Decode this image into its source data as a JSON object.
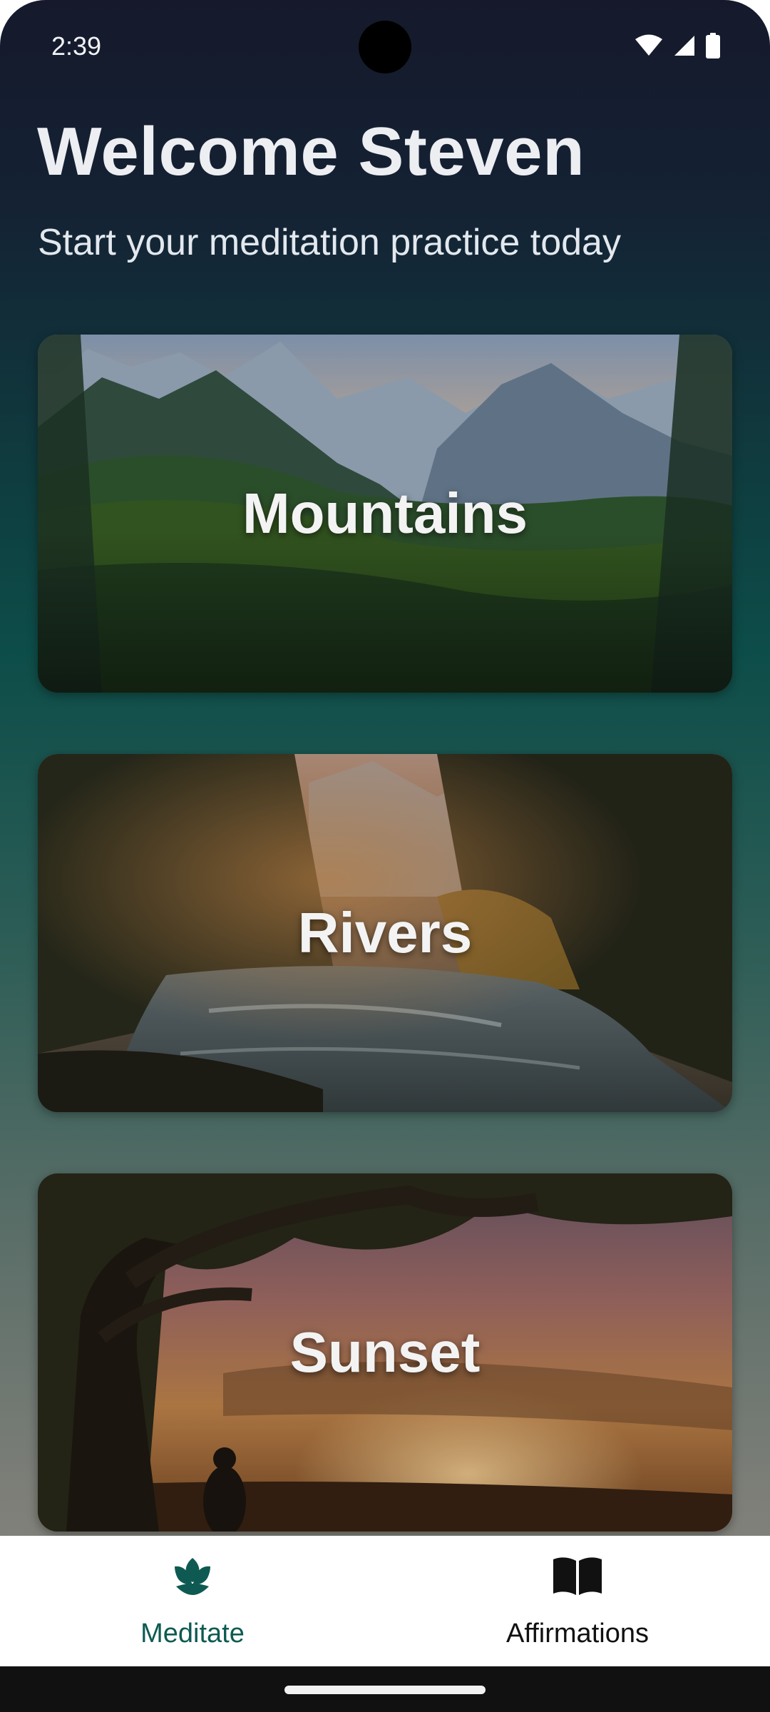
{
  "status_bar": {
    "time": "2:39",
    "icons": [
      "wifi-icon",
      "cellular-signal-icon",
      "battery-icon"
    ]
  },
  "header": {
    "title": "Welcome Steven",
    "subtitle": "Start your meditation practice today"
  },
  "cards": [
    {
      "label": "Mountains",
      "image": "mountain-forest-landscape"
    },
    {
      "label": "Rivers",
      "image": "forest-river-landscape"
    },
    {
      "label": "Sunset",
      "image": "tree-sunset-landscape"
    }
  ],
  "bottom_nav": {
    "items": [
      {
        "label": "Meditate",
        "icon": "lotus-icon",
        "active": true
      },
      {
        "label": "Affirmations",
        "icon": "open-book-icon",
        "active": false
      }
    ],
    "active_color": "#0e5a52",
    "inactive_color": "#111111"
  }
}
